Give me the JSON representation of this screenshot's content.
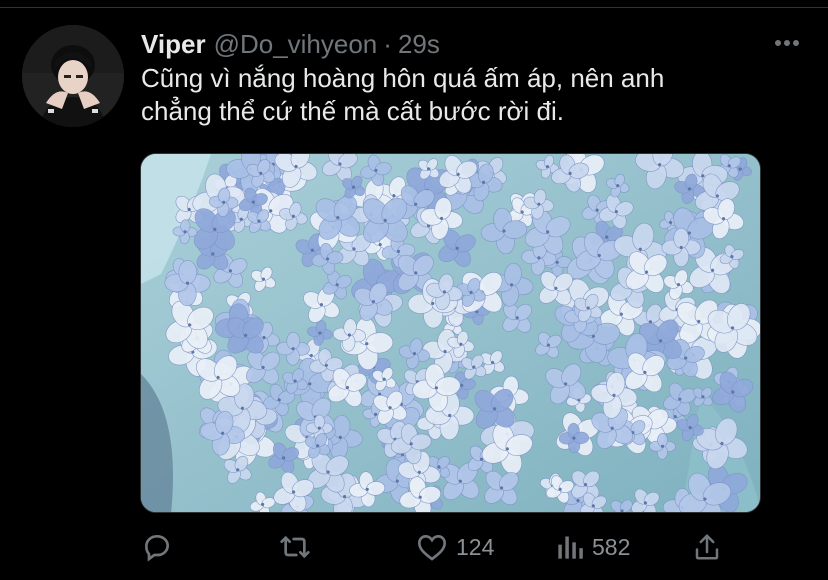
{
  "tweet": {
    "author_name": "Viper",
    "handle": "@Do_vihyeon",
    "separator": "·",
    "time": "29s",
    "text_line1": "Cũng vì nắng hoàng hôn quá ấm áp, nên anh",
    "text_line2": "chẳng thể cứ thế mà cất bước rời đi."
  },
  "actions": {
    "likes": "124",
    "views": "582"
  },
  "icons": {
    "more": "more-horizontal-icon",
    "reply": "reply-icon",
    "retweet": "retweet-icon",
    "like": "heart-icon",
    "views": "analytics-icon",
    "share": "share-icon"
  },
  "colors": {
    "background": "#000000",
    "text": "#e7e9ea",
    "secondary": "#71767b",
    "media_accent": "#8fb3d9"
  }
}
